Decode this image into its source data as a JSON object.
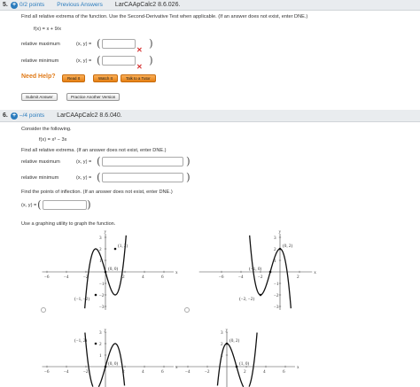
{
  "q5": {
    "number": "5.",
    "points": "0/2 points",
    "previous": "Previous Answers",
    "code": "LarCAApCalc2 8.6.026.",
    "instruction": "Find all relative extrema of the function. Use the Second-Derivative Test when applicable. (If an answer does not exist, enter DNE.)",
    "function": "f(x) = x + 9/x",
    "rel_max_label": "relative maximum",
    "rel_min_label": "relative minimum",
    "xy_label": "(x, y) =",
    "need_help": "Need Help?",
    "read_it": "Read It",
    "watch_it": "Watch It",
    "talk_tutor": "Talk to a Tutor",
    "submit": "Submit Answer",
    "practice": "Practice Another Version"
  },
  "q6": {
    "number": "6.",
    "points": "–/4 points",
    "code": "LarCAApCalc2 8.6.040.",
    "intro": "Consider the following.",
    "function": "f(x) = x³ − 3x",
    "find_extrema": "Find all relative extrema. (If an answer does not exist, enter DNE.)",
    "rel_max_label": "relative maximum",
    "rel_min_label": "relative minimum",
    "xy_label": "(x, y) =",
    "find_inflection": "Find the points of inflection. (If an answer does not exist, enter DNE.)",
    "graph_prompt": "Use a graphing utility to graph the function.",
    "graphs": [
      {
        "x_ticks": [
          "−6",
          "−4",
          "−2",
          "2",
          "4",
          "6"
        ],
        "y_ticks": [
          "3",
          "2",
          "1",
          "−1",
          "−2",
          "−3"
        ],
        "points": [
          "(1, 2)",
          "(0, 0)",
          "(−1, −2)"
        ],
        "axis_x": "x",
        "axis_y": "y"
      },
      {
        "x_ticks": [
          "−6",
          "−4",
          "−2",
          "2"
        ],
        "y_ticks": [
          "3",
          "2",
          "1",
          "−1",
          "−2",
          "−3"
        ],
        "points": [
          "(0, 2)",
          "(−1, 0)",
          "(−2, −2)"
        ],
        "axis_x": "x",
        "axis_y": "y"
      },
      {
        "x_ticks": [
          "−6",
          "−4",
          "−2",
          "2",
          "4",
          "6"
        ],
        "y_ticks": [
          "3",
          "2",
          "1"
        ],
        "points": [
          "(−1, 2)",
          "(0, 0)"
        ],
        "axis_x": "x",
        "axis_y": "y"
      },
      {
        "x_ticks": [
          "−4",
          "−2",
          "2",
          "4",
          "6"
        ],
        "y_ticks": [
          "3",
          "2",
          "1"
        ],
        "points": [
          "(0, 2)",
          "(1, 0)"
        ],
        "axis_x": "x",
        "axis_y": "y"
      }
    ]
  }
}
